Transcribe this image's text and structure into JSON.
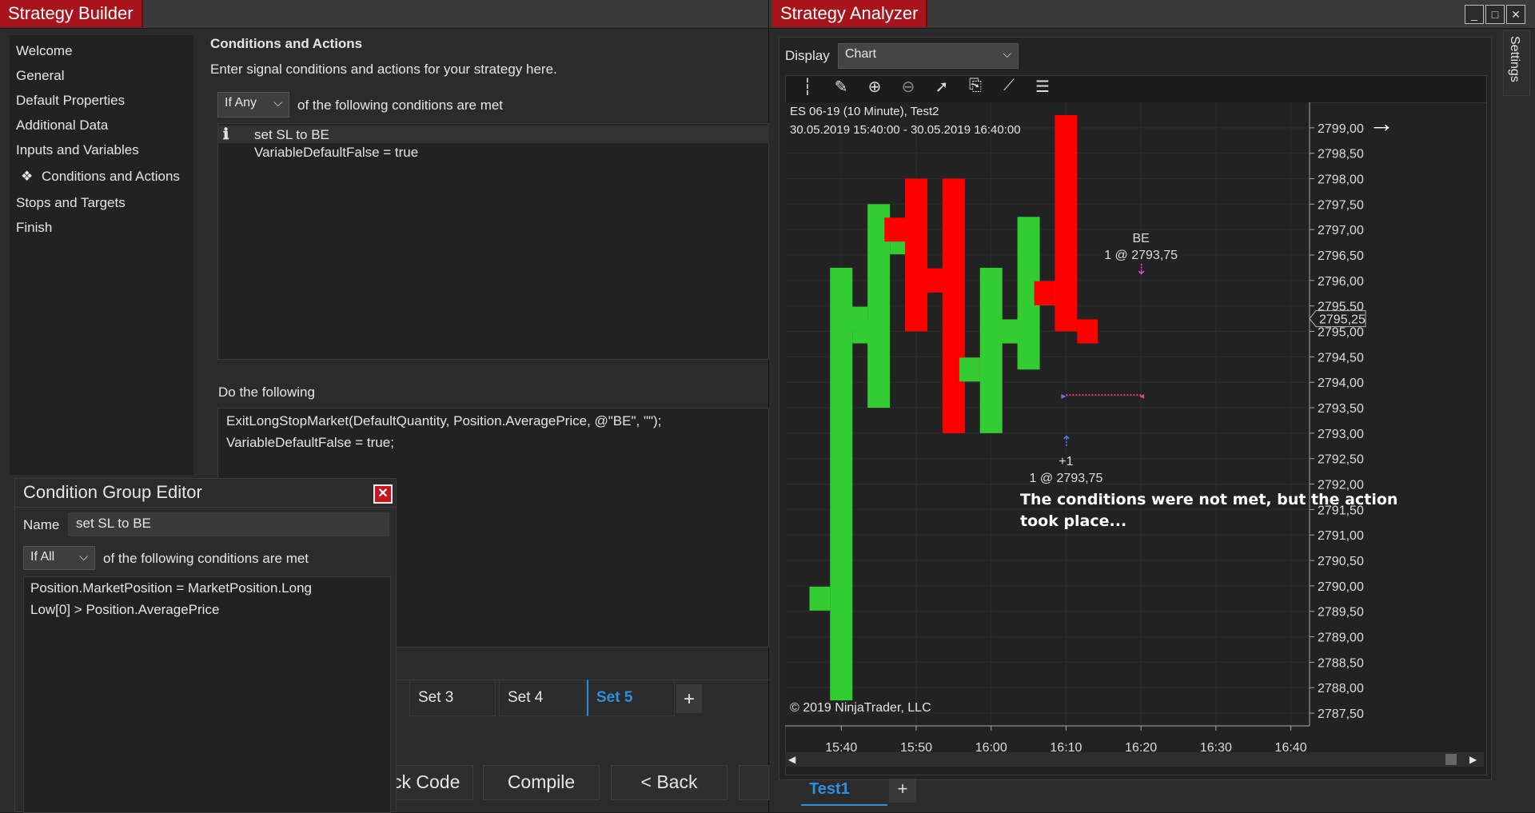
{
  "builder": {
    "title": "Strategy Builder",
    "nav": [
      {
        "label": "Welcome",
        "active": false
      },
      {
        "label": "General",
        "active": false
      },
      {
        "label": "Default Properties",
        "active": false
      },
      {
        "label": "Additional Data",
        "active": false
      },
      {
        "label": "Inputs and Variables",
        "active": false
      },
      {
        "label": "Conditions and Actions",
        "active": true,
        "prefix": "❖"
      },
      {
        "label": "Stops and Targets",
        "active": false
      },
      {
        "label": "Finish",
        "active": false
      }
    ],
    "section_title": "Conditions and Actions",
    "section_desc": "Enter signal conditions and actions for your strategy here.",
    "if_dropdown": "If Any",
    "if_suffix": "of the following conditions are met",
    "condition_group": "set SL to BE",
    "condition_line2": "VariableDefaultFalse = true",
    "do_label": "Do the following",
    "actions": [
      "ExitLongStopMarket(DefaultQuantity, Position.AveragePrice, @\"BE\", \"\");",
      "VariableDefaultFalse = true;"
    ],
    "sets": [
      "Set 3",
      "Set 4",
      "Set 5"
    ],
    "active_set": "Set 5",
    "add_set": "+",
    "buttons": [
      "ck Code",
      "Compile",
      "< Back"
    ]
  },
  "editor": {
    "title": "Condition Group Editor",
    "name_label": "Name",
    "name_value": "set SL to BE",
    "if_dropdown": "If All",
    "if_suffix": "of the following conditions are met",
    "conditions": [
      "Position.MarketPosition = MarketPosition.Long",
      "Low[0] > Position.AveragePrice"
    ]
  },
  "analyzer": {
    "title": "Strategy Analyzer",
    "display_label": "Display",
    "display_value": "Chart",
    "settings_tab": "Settings",
    "instrument": "ES 06-19 (10 Minute), Test2",
    "range": "30.05.2019 15:40:00 - 30.05.2019 16:40:00",
    "copyright": "© 2019 NinjaTrader, LLC",
    "note": "The conditions were not met, but the action took place...",
    "tab": "Test1",
    "add_tab": "+",
    "colors": {
      "up": "#33cc33",
      "down": "#ff0000",
      "bg": "#222222"
    }
  },
  "chart_data": {
    "type": "ohlc",
    "x": [
      "15:35",
      "15:40",
      "15:45",
      "15:50",
      "15:55",
      "16:00",
      "16:05",
      "16:10",
      "16:15",
      "16:20",
      "16:25",
      "16:30",
      "16:35",
      "16:40"
    ],
    "xticks": [
      "15:40",
      "15:50",
      "16:00",
      "16:10",
      "16:20",
      "16:30",
      "16:40"
    ],
    "bars": [
      {
        "t": "15:35",
        "o": null,
        "h": null,
        "l": null,
        "c": null
      },
      {
        "t": "15:40",
        "o": 2789.75,
        "h": 2796.25,
        "l": 2787.75,
        "c": 2795.0
      },
      {
        "t": "15:45",
        "o": 2795.25,
        "h": 2797.5,
        "l": 2793.5,
        "c": 2796.75
      },
      {
        "t": "15:50",
        "o": 2797.0,
        "h": 2798.0,
        "l": 2795.0,
        "c": 2796.0
      },
      {
        "t": "15:55",
        "o": 2796.0,
        "h": 2798.0,
        "l": 2793.0,
        "c": 2794.25
      },
      {
        "t": "16:00",
        "o": 2794.25,
        "h": 2796.25,
        "l": 2793.0,
        "c": 2795.0
      },
      {
        "t": "16:05",
        "o": 2795.0,
        "h": 2797.25,
        "l": 2794.25,
        "c": 2795.75
      },
      {
        "t": "16:10",
        "o": 2795.75,
        "h": 2799.25,
        "l": 2795.0,
        "c": 2795.0
      }
    ],
    "yticks": [
      "2799,00",
      "2798,50",
      "2798,00",
      "2797,50",
      "2797,00",
      "2796,50",
      "2796,00",
      "2795,50",
      "2795,00",
      "2794,50",
      "2794,00",
      "2793,50",
      "2793,00",
      "2792,50",
      "2792,00",
      "2791,50",
      "2791,00",
      "2790,50",
      "2790,00",
      "2789,50",
      "2789,00",
      "2788,50",
      "2788,00",
      "2787,50"
    ],
    "ylim": [
      2787.25,
      2799.5
    ],
    "last_price": "2795,25",
    "entry_label1": "+1",
    "entry_label2": "1 @ 2793,75",
    "exit_label1": "BE",
    "exit_label2": "1 @ 2793,75"
  }
}
